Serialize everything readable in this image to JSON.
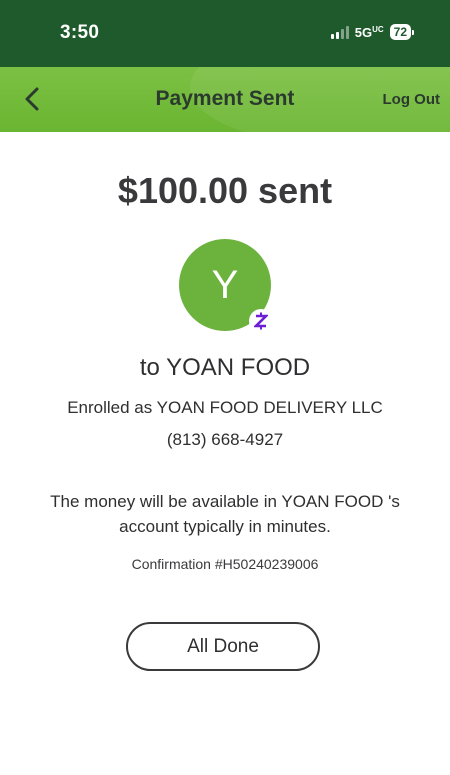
{
  "status_bar": {
    "time": "3:50",
    "network": "5G",
    "network_suffix": "UC",
    "battery": "72"
  },
  "header": {
    "title": "Payment Sent",
    "logout_label": "Log Out",
    "back_icon": "chevron-left-icon"
  },
  "payment": {
    "amount_text": "$100.00 sent",
    "avatar_initial": "Y",
    "badge_icon": "zelle-icon",
    "recipient_line": "to YOAN FOOD",
    "enrolled_line": "Enrolled as YOAN FOOD DELIVERY LLC",
    "phone": "(813) 668-4927",
    "availability_message": "The money will be available in YOAN FOOD 's account typically in minutes.",
    "confirmation": "Confirmation #H50240239006"
  },
  "actions": {
    "done_label": "All Done"
  },
  "colors": {
    "status_bar": "#1e5a2c",
    "header": "#7cc043",
    "avatar": "#6cb33e",
    "zelle": "#6d1ed4"
  }
}
